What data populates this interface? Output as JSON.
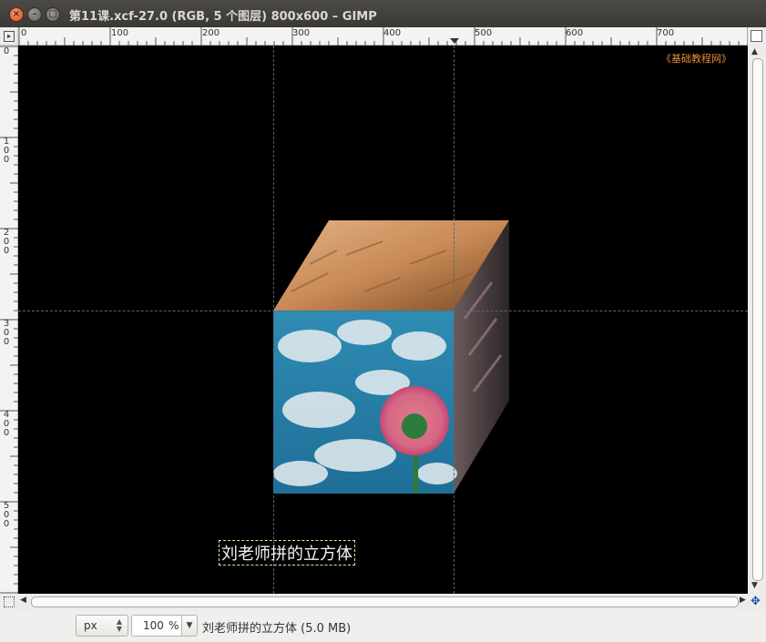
{
  "window": {
    "title": "第11课.xcf-27.0 (RGB, 5 个图层) 800x600 – GIMP",
    "close_symbol": "×",
    "min_symbol": "–",
    "max_symbol": "□"
  },
  "rulers": {
    "horizontal_labels": [
      "0",
      "100",
      "200",
      "300",
      "400",
      "500",
      "600",
      "700"
    ],
    "vertical_labels": [
      "0",
      "100",
      "200",
      "300",
      "400",
      "500"
    ]
  },
  "canvas": {
    "watermark": "《基础教程网》",
    "caption": "刘老师拼的立方体"
  },
  "statusbar": {
    "unit": "px",
    "zoom_value": "100",
    "zoom_unit": "%",
    "image_info": "刘老师拼的立方体 (5.0 MB)"
  },
  "icons": {
    "ruler_corner": "quick-mask-toggle-icon",
    "navigate": "navigate-icon",
    "zoom_follow": "zoom-image-icon"
  },
  "colors": {
    "canvas_background": "#000000",
    "watermark": "#e8883a",
    "titlebar": "#3c3b37"
  }
}
